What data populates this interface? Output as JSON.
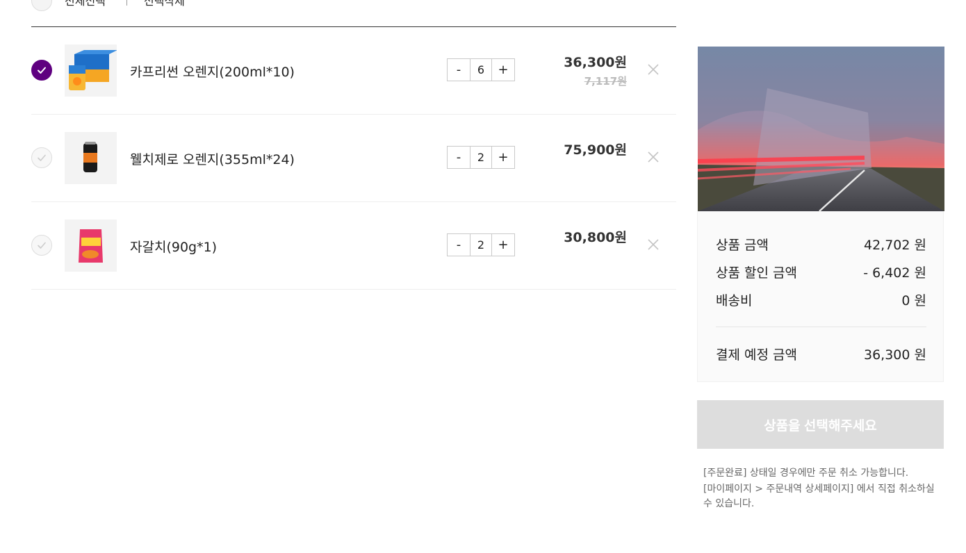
{
  "top": {
    "select_all_label": "전체선택",
    "delete_selected_label": "선택삭제"
  },
  "items": [
    {
      "name": "카프리썬 오렌지(200ml*10)",
      "qty": "6",
      "price": "36,300원",
      "orig_price": "7,117원",
      "checked": true
    },
    {
      "name": "웰치제로 오렌지(355ml*24)",
      "qty": "2",
      "price": "75,900원",
      "orig_price": "",
      "checked": false
    },
    {
      "name": "자갈치(90g*1)",
      "qty": "2",
      "price": "30,800원",
      "orig_price": "",
      "checked": false
    }
  ],
  "stepper": {
    "minus": "-",
    "plus": "+"
  },
  "summary": {
    "product_amount_label": "상품 금액",
    "product_amount_value": "42,702 원",
    "discount_label": "상품 할인 금액",
    "discount_value": "- 6,402 원",
    "shipping_label": "배송비",
    "shipping_value": "0 원",
    "total_label": "결제 예정 금액",
    "total_value": "36,300 원"
  },
  "order_button_label": "상품을 선택해주세요",
  "notice": [
    "[주문완료] 상태일 경우에만 주문 취소 가능합니다.",
    "[마이페이지 > 주문내역 상세페이지] 에서 직접 취소하실 수 있습니다."
  ],
  "colors": {
    "accent": "#5f0080",
    "button_disabled": "#dddddd"
  },
  "icons": {
    "check": "check-icon",
    "remove": "close-icon"
  }
}
